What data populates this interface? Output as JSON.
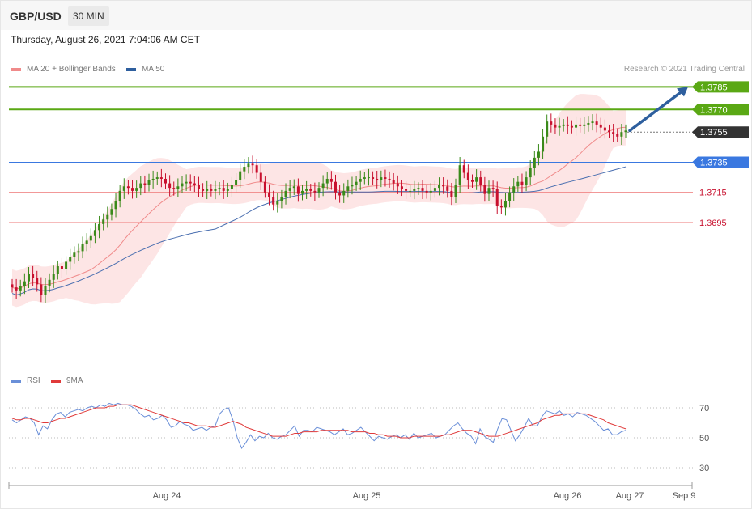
{
  "header": {
    "symbol": "GBP/USD",
    "timeframe": "30 MIN"
  },
  "datetime": "Thursday, August 26, 2021 7:04:06 AM CET",
  "legend": {
    "ma20": "MA 20 + Bollinger Bands",
    "ma50": "MA 50",
    "credit": "Research © 2021 Trading Central"
  },
  "rsi_legend": {
    "rsi": "RSI",
    "ma9": "9MA"
  },
  "colors": {
    "up": "#3a8a1a",
    "down": "#c8102e",
    "ma20": "#f08a8a",
    "ma50": "#4a6fb0",
    "band": "#fde2e2",
    "resistance": "#5aa814",
    "pivot": "#3a78e0",
    "support": "#ee7777",
    "current": "#333333",
    "arrow": "#2e5f9e",
    "rsi": "#6a8fd8",
    "rsi_ma": "#e03a3a"
  },
  "chart_data": [
    {
      "type": "candlestick",
      "title": "GBP/USD",
      "timeframe": "30 MIN",
      "ylim": [
        1.36,
        1.379
      ],
      "x_ticks": [
        "Aug 24",
        "Aug 25",
        "Aug 26",
        "Aug 27",
        "Sep 9"
      ],
      "levels": [
        {
          "value": "1.3785",
          "kind": "resistance"
        },
        {
          "value": "1.3770",
          "kind": "resistance"
        },
        {
          "value": "1.3755",
          "kind": "current"
        },
        {
          "value": "1.3735",
          "kind": "pivot"
        },
        {
          "value": "1.3715",
          "kind": "support"
        },
        {
          "value": "1.3695",
          "kind": "support"
        }
      ],
      "forecast": {
        "from": 1.3756,
        "to": 1.3785,
        "direction": "up"
      },
      "closes": [
        1.3652,
        1.365,
        1.3653,
        1.3656,
        1.3661,
        1.3658,
        1.3654,
        1.3647,
        1.3653,
        1.3657,
        1.3661,
        1.3666,
        1.3664,
        1.3669,
        1.3672,
        1.3675,
        1.3676,
        1.3681,
        1.3683,
        1.3686,
        1.369,
        1.3694,
        1.3697,
        1.37,
        1.3704,
        1.3709,
        1.3716,
        1.3719,
        1.3718,
        1.3716,
        1.3718,
        1.3721,
        1.372,
        1.3723,
        1.3724,
        1.3725,
        1.3724,
        1.3721,
        1.3718,
        1.3717,
        1.3719,
        1.3721,
        1.3722,
        1.3721,
        1.372,
        1.3717,
        1.3716,
        1.3717,
        1.3716,
        1.3717,
        1.3718,
        1.3716,
        1.3717,
        1.372,
        1.3723,
        1.3729,
        1.3732,
        1.3734,
        1.3733,
        1.3728,
        1.3722,
        1.3715,
        1.3712,
        1.3707,
        1.3709,
        1.3712,
        1.3716,
        1.3718,
        1.3719,
        1.3714,
        1.3716,
        1.3717,
        1.3716,
        1.3715,
        1.3718,
        1.3721,
        1.3724,
        1.3722,
        1.3715,
        1.3713,
        1.3716,
        1.3719,
        1.372,
        1.3722,
        1.3724,
        1.3725,
        1.3725,
        1.3724,
        1.3723,
        1.3725,
        1.3724,
        1.3723,
        1.3721,
        1.3719,
        1.3717,
        1.3716,
        1.3716,
        1.3717,
        1.3718,
        1.3716,
        1.3715,
        1.3716,
        1.3718,
        1.372,
        1.3719,
        1.3716,
        1.3712,
        1.372,
        1.3733,
        1.3728,
        1.3723,
        1.3722,
        1.3725,
        1.372,
        1.3714,
        1.3718,
        1.3717,
        1.3706,
        1.3705,
        1.3709,
        1.3715,
        1.3719,
        1.3722,
        1.372,
        1.3725,
        1.3731,
        1.3738,
        1.3742,
        1.3752,
        1.3762,
        1.376,
        1.3758,
        1.3759,
        1.376,
        1.3759,
        1.3758,
        1.376,
        1.3759,
        1.376,
        1.3761,
        1.3762,
        1.376,
        1.3758,
        1.3756,
        1.3755,
        1.3754,
        1.3752,
        1.3755,
        1.3756
      ]
    },
    {
      "type": "line",
      "title": "RSI",
      "ylim": [
        25,
        75
      ],
      "y_ticks": [
        "70",
        "50",
        "30"
      ],
      "series": [
        {
          "name": "RSI",
          "values": [
            62,
            60,
            62,
            64,
            63,
            60,
            52,
            58,
            56,
            62,
            66,
            67,
            64,
            67,
            68,
            69,
            68,
            70,
            71,
            70,
            72,
            71,
            73,
            72,
            73,
            72,
            72,
            71,
            69,
            66,
            64,
            65,
            62,
            63,
            65,
            62,
            57,
            58,
            61,
            59,
            58,
            55,
            56,
            57,
            55,
            57,
            58,
            66,
            69,
            70,
            62,
            50,
            43,
            47,
            52,
            48,
            51,
            50,
            53,
            50,
            49,
            51,
            52,
            55,
            58,
            51,
            55,
            55,
            54,
            57,
            56,
            55,
            54,
            52,
            54,
            56,
            52,
            53,
            55,
            57,
            54,
            51,
            48,
            51,
            50,
            49,
            51,
            52,
            50,
            52,
            49,
            53,
            50,
            51,
            52,
            53,
            50,
            51,
            52,
            55,
            58,
            60,
            56,
            53,
            51,
            46,
            56,
            51,
            49,
            47,
            56,
            63,
            62,
            55,
            48,
            52,
            57,
            63,
            58,
            58,
            64,
            68,
            67,
            66,
            68,
            65,
            66,
            64,
            67,
            66,
            65,
            63,
            61,
            58,
            55,
            56,
            52,
            52,
            54,
            55
          ]
        },
        {
          "name": "9MA",
          "values": [
            63,
            62,
            62,
            63,
            63,
            62,
            61,
            60,
            60,
            61,
            62,
            63,
            63,
            64,
            65,
            66,
            67,
            68,
            69,
            70,
            70,
            70,
            71,
            71,
            72,
            72,
            72,
            72,
            71,
            70,
            69,
            68,
            67,
            66,
            65,
            64,
            63,
            62,
            61,
            60,
            60,
            59,
            58,
            58,
            58,
            57,
            57,
            58,
            59,
            60,
            61,
            60,
            59,
            57,
            56,
            55,
            54,
            53,
            52,
            51,
            51,
            51,
            51,
            52,
            53,
            53,
            54,
            54,
            54,
            54,
            55,
            55,
            55,
            55,
            55,
            55,
            55,
            54,
            54,
            54,
            54,
            53,
            53,
            52,
            52,
            51,
            51,
            51,
            50,
            50,
            50,
            51,
            51,
            51,
            51,
            51,
            51,
            51,
            52,
            52,
            53,
            54,
            55,
            55,
            55,
            54,
            53,
            52,
            51,
            51,
            51,
            52,
            53,
            54,
            55,
            56,
            57,
            58,
            59,
            60,
            62,
            63,
            64,
            65,
            65,
            66,
            66,
            66,
            66,
            66,
            66,
            65,
            64,
            63,
            62,
            60,
            59,
            58,
            57,
            56
          ]
        }
      ]
    }
  ]
}
